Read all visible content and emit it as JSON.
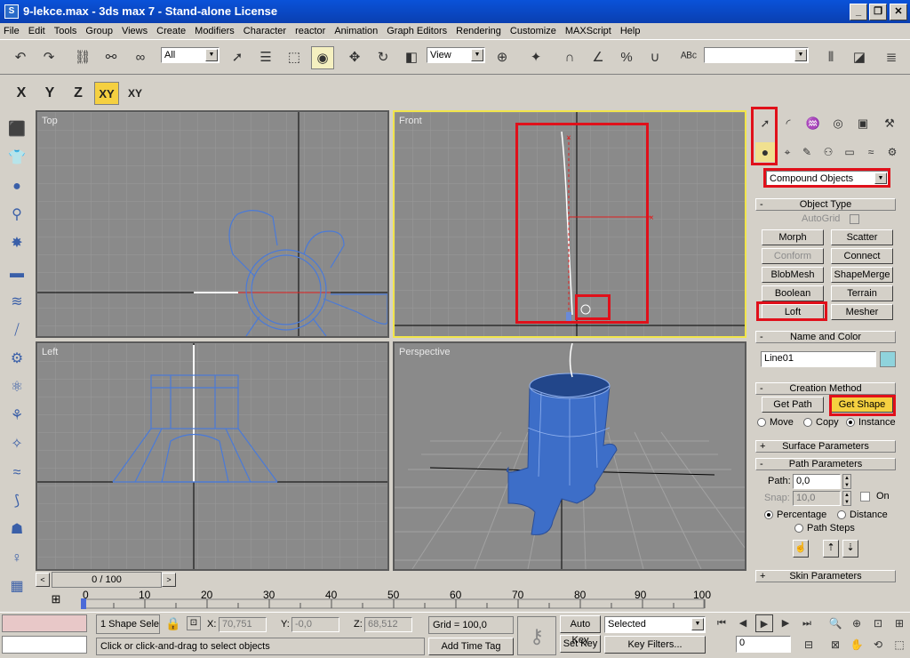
{
  "window": {
    "title": "9-lekce.max - 3ds max 7 - Stand-alone License",
    "app_icon": "3ds-max-icon"
  },
  "menu": [
    "File",
    "Edit",
    "Tools",
    "Group",
    "Views",
    "Create",
    "Modifiers",
    "Character",
    "reactor",
    "Animation",
    "Graph Editors",
    "Rendering",
    "Customize",
    "MAXScript",
    "Help"
  ],
  "toolbar": {
    "selection_filter": "All",
    "ref_coord": "View",
    "named_selection": ""
  },
  "axis": {
    "x": "X",
    "y": "Y",
    "z": "Z",
    "xy": "XY",
    "xy2": "XY"
  },
  "viewports": {
    "top": "Top",
    "front": "Front",
    "left": "Left",
    "perspective": "Perspective"
  },
  "panel": {
    "category": "Compound Objects",
    "object_type": {
      "header": "Object Type",
      "autogrid": "AutoGrid",
      "buttons": [
        "Morph",
        "Scatter",
        "Conform",
        "Connect",
        "BlobMesh",
        "ShapeMerge",
        "Boolean",
        "Terrain",
        "Loft",
        "Mesher"
      ]
    },
    "name_color": {
      "header": "Name and Color",
      "name": "Line01",
      "color": "#8fd3dc"
    },
    "creation_method": {
      "header": "Creation Method",
      "get_path": "Get Path",
      "get_shape": "Get Shape",
      "move": "Move",
      "copy": "Copy",
      "instance": "Instance"
    },
    "surface_parameters": "Surface Parameters",
    "path_parameters": {
      "header": "Path Parameters",
      "path_label": "Path:",
      "path_value": "0,0",
      "snap_label": "Snap:",
      "snap_value": "10,0",
      "on": "On",
      "percentage": "Percentage",
      "distance": "Distance",
      "path_steps": "Path Steps"
    },
    "skin_parameters": "Skin Parameters"
  },
  "timeline": {
    "frame": "0 / 100",
    "ticks": [
      "0",
      "10",
      "20",
      "30",
      "40",
      "50",
      "60",
      "70",
      "80",
      "90",
      "100"
    ]
  },
  "status": {
    "selection": "1 Shape Sele",
    "x_label": "X:",
    "x": "70,751",
    "y_label": "Y:",
    "y": "-0,0",
    "z_label": "Z:",
    "z": "68,512",
    "grid": "Grid = 100,0",
    "prompt": "Click or click-and-drag to select objects",
    "add_time_tag": "Add Time Tag",
    "auto_key": "Auto Key",
    "set_key": "Set Key",
    "selected": "Selected",
    "key_filters": "Key Filters...",
    "frame_field": "0"
  }
}
